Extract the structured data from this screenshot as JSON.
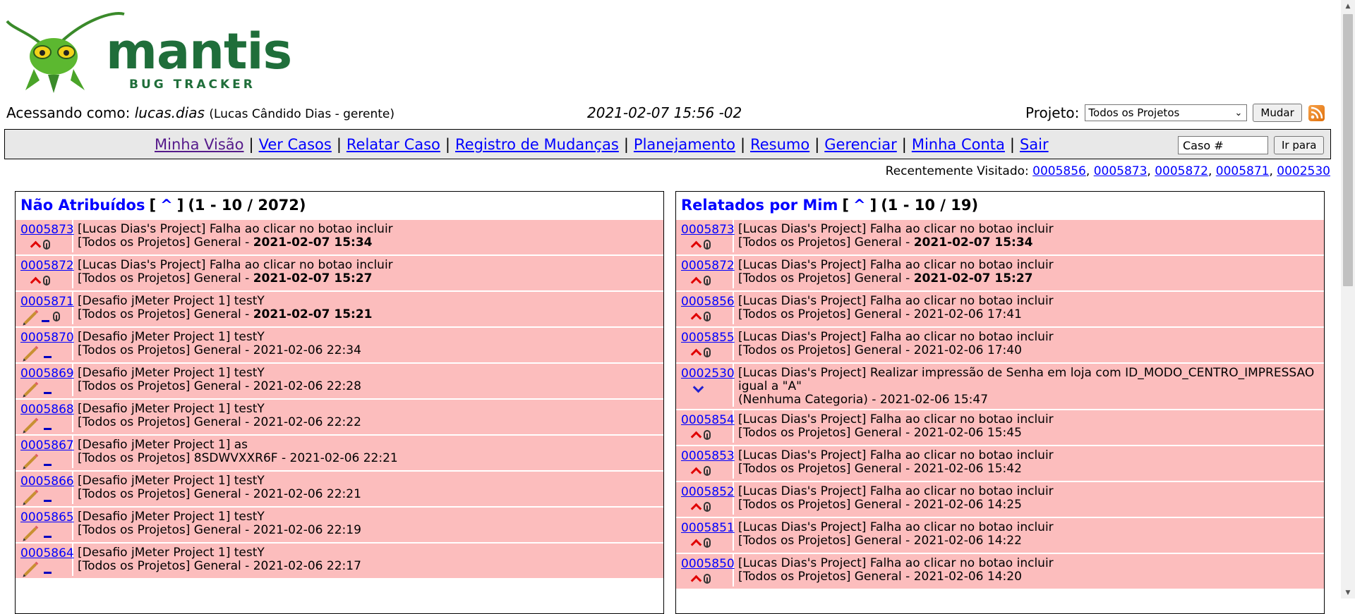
{
  "logo": {
    "name": "mantis",
    "tagline": "BUG TRACKER"
  },
  "login": {
    "prefix": "Acessando como:",
    "username": "lucas.dias",
    "detail": "(Lucas Cândido Dias - gerente)"
  },
  "datetime": "2021-02-07 15:56 -02",
  "project": {
    "label": "Projeto:",
    "selected": "Todos os Projetos",
    "button": "Mudar"
  },
  "menu": [
    {
      "label": "Minha Visão",
      "visited": true
    },
    {
      "label": "Ver Casos"
    },
    {
      "label": "Relatar Caso"
    },
    {
      "label": "Registro de Mudanças"
    },
    {
      "label": "Planejamento"
    },
    {
      "label": "Resumo"
    },
    {
      "label": "Gerenciar"
    },
    {
      "label": "Minha Conta"
    },
    {
      "label": "Sair"
    }
  ],
  "menu_separator": "|",
  "jump": {
    "placeholder": "Caso #",
    "button": "Ir para"
  },
  "recent": {
    "label": "Recentemente Visitado:",
    "ids": [
      "0005856",
      "0005873",
      "0005872",
      "0005871",
      "0002530"
    ],
    "separator": ", "
  },
  "panels": [
    {
      "title": "Não Atribuídos",
      "caret": "^",
      "count": "(1 - 10 / 2072)",
      "rows": [
        {
          "id": "0005873",
          "icons": [
            "pri-high",
            "clip"
          ],
          "line1": "[Lucas Dias's Project] Falha ao clicar no botao incluir",
          "line2": "[Todos os Projetos] General - ",
          "date": "2021-02-07 15:34",
          "bold_date": true
        },
        {
          "id": "0005872",
          "icons": [
            "pri-high",
            "clip"
          ],
          "line1": "[Lucas Dias's Project] Falha ao clicar no botao incluir",
          "line2": "[Todos os Projetos] General - ",
          "date": "2021-02-07 15:27",
          "bold_date": true
        },
        {
          "id": "0005871",
          "icons": [
            "pencil",
            "minus",
            "clip"
          ],
          "line1": "[Desafio jMeter Project 1] testY",
          "line2": "[Todos os Projetos] General - ",
          "date": "2021-02-07 15:21",
          "bold_date": true
        },
        {
          "id": "0005870",
          "icons": [
            "pencil",
            "minus"
          ],
          "line1": "[Desafio jMeter Project 1] testY",
          "line2": "[Todos os Projetos] General - ",
          "date": "2021-02-06 22:34",
          "bold_date": false
        },
        {
          "id": "0005869",
          "icons": [
            "pencil",
            "minus"
          ],
          "line1": "[Desafio jMeter Project 1] testY",
          "line2": "[Todos os Projetos] General - ",
          "date": "2021-02-06 22:28",
          "bold_date": false
        },
        {
          "id": "0005868",
          "icons": [
            "pencil",
            "minus"
          ],
          "line1": "[Desafio jMeter Project 1] testY",
          "line2": "[Todos os Projetos] General - ",
          "date": "2021-02-06 22:22",
          "bold_date": false
        },
        {
          "id": "0005867",
          "icons": [
            "pencil",
            "minus"
          ],
          "line1": "[Desafio jMeter Project 1] as",
          "line2": "[Todos os Projetos] 8SDWVXXR6F - ",
          "date": "2021-02-06 22:21",
          "bold_date": false
        },
        {
          "id": "0005866",
          "icons": [
            "pencil",
            "minus"
          ],
          "line1": "[Desafio jMeter Project 1] testY",
          "line2": "[Todos os Projetos] General - ",
          "date": "2021-02-06 22:21",
          "bold_date": false
        },
        {
          "id": "0005865",
          "icons": [
            "pencil",
            "minus"
          ],
          "line1": "[Desafio jMeter Project 1] testY",
          "line2": "[Todos os Projetos] General - ",
          "date": "2021-02-06 22:19",
          "bold_date": false
        },
        {
          "id": "0005864",
          "icons": [
            "pencil",
            "minus"
          ],
          "line1": "[Desafio jMeter Project 1] testY",
          "line2": "[Todos os Projetos] General - ",
          "date": "2021-02-06 22:17",
          "bold_date": false
        }
      ]
    },
    {
      "title": "Relatados por Mim",
      "caret": "^",
      "count": "(1 - 10 / 19)",
      "rows": [
        {
          "id": "0005873",
          "icons": [
            "pri-high",
            "clip"
          ],
          "line1": "[Lucas Dias's Project] Falha ao clicar no botao incluir",
          "line2": "[Todos os Projetos] General - ",
          "date": "2021-02-07 15:34",
          "bold_date": true
        },
        {
          "id": "0005872",
          "icons": [
            "pri-high",
            "clip"
          ],
          "line1": "[Lucas Dias's Project] Falha ao clicar no botao incluir",
          "line2": "[Todos os Projetos] General - ",
          "date": "2021-02-07 15:27",
          "bold_date": true
        },
        {
          "id": "0005856",
          "icons": [
            "pri-high",
            "clip"
          ],
          "line1": "[Lucas Dias's Project] Falha ao clicar no botao incluir",
          "line2": "[Todos os Projetos] General - ",
          "date": "2021-02-06 17:41",
          "bold_date": false
        },
        {
          "id": "0005855",
          "icons": [
            "pri-high",
            "clip"
          ],
          "line1": "[Lucas Dias's Project] Falha ao clicar no botao incluir",
          "line2": "[Todos os Projetos] General - ",
          "date": "2021-02-06 17:40",
          "bold_date": false
        },
        {
          "id": "0002530",
          "icons": [
            "pri-low"
          ],
          "line1": "[Lucas Dias's Project] Realizar impressão de Senha em loja com ID_MODO_CENTRO_IMPRESSAO igual a \"A\"",
          "line2": "(Nenhuma Categoria) - ",
          "date": "2021-02-06 15:47",
          "bold_date": false
        },
        {
          "id": "0005854",
          "icons": [
            "pri-high",
            "clip"
          ],
          "line1": "[Lucas Dias's Project] Falha ao clicar no botao incluir",
          "line2": "[Todos os Projetos] General - ",
          "date": "2021-02-06 15:45",
          "bold_date": false
        },
        {
          "id": "0005853",
          "icons": [
            "pri-high",
            "clip"
          ],
          "line1": "[Lucas Dias's Project] Falha ao clicar no botao incluir",
          "line2": "[Todos os Projetos] General - ",
          "date": "2021-02-06 15:42",
          "bold_date": false
        },
        {
          "id": "0005852",
          "icons": [
            "pri-high",
            "clip"
          ],
          "line1": "[Lucas Dias's Project] Falha ao clicar no botao incluir",
          "line2": "[Todos os Projetos] General - ",
          "date": "2021-02-06 14:25",
          "bold_date": false
        },
        {
          "id": "0005851",
          "icons": [
            "pri-high",
            "clip"
          ],
          "line1": "[Lucas Dias's Project] Falha ao clicar no botao incluir",
          "line2": "[Todos os Projetos] General - ",
          "date": "2021-02-06 14:22",
          "bold_date": false
        },
        {
          "id": "0005850",
          "icons": [
            "pri-high",
            "clip"
          ],
          "line1": "[Lucas Dias's Project] Falha ao clicar no botao incluir",
          "line2": "[Todos os Projetos] General - ",
          "date": "2021-02-06 14:20",
          "bold_date": false
        }
      ]
    }
  ],
  "colors": {
    "row_bg": "#fcbdbd",
    "link": "#0000ff",
    "menu_bg": "#e8e8e8",
    "logo_green": "#1f6e3a"
  }
}
